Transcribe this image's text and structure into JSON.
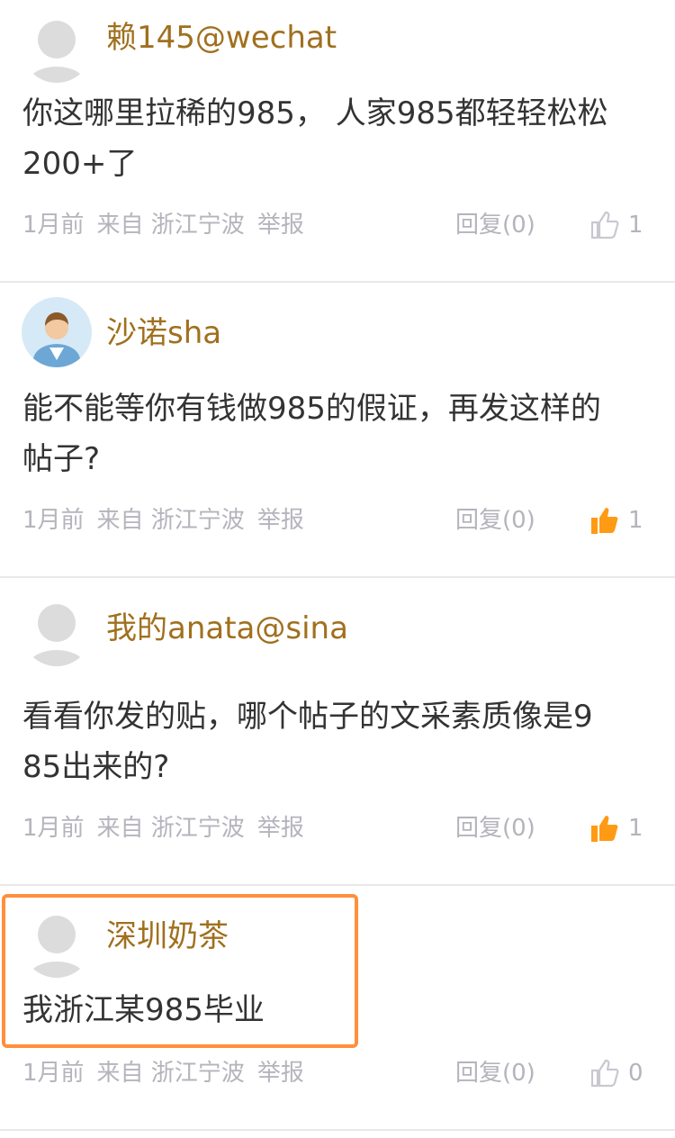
{
  "comments": [
    {
      "username": "赖145@wechat",
      "avatar": "default-avatar-icon",
      "content": "你这哪里拉稀的985， 人家985都轻轻松松\n200+了",
      "time": "1月前",
      "source": "来自 浙江宁波",
      "report": "举报",
      "reply": "回复(0)",
      "likes": "1",
      "liked": false
    },
    {
      "username": "沙诺sha",
      "avatar": "user-photo-avatar-icon",
      "content": "能不能等你有钱做985的假证，再发这样的\n帖子?",
      "time": "1月前",
      "source": "来自 浙江宁波",
      "report": "举报",
      "reply": "回复(0)",
      "likes": "1",
      "liked": true
    },
    {
      "username": "我的anata@sina",
      "avatar": "default-avatar-icon",
      "content": "看看你发的贴，哪个帖子的文采素质像是9\n85出来的?",
      "time": "1月前",
      "source": "来自 浙江宁波",
      "report": "举报",
      "reply": "回复(0)",
      "likes": "1",
      "liked": true
    },
    {
      "username": "深圳奶茶",
      "avatar": "default-avatar-icon",
      "content": "我浙江某985毕业",
      "time": "1月前",
      "source": "来自 浙江宁波",
      "report": "举报",
      "reply": "回复(0)",
      "likes": "0",
      "liked": false,
      "highlighted": true
    }
  ],
  "colors": {
    "username": "#a0701e",
    "content": "#333333",
    "meta": "#b4b4bc",
    "like_active": "#ff9a14",
    "highlight_border": "#ff8f3c",
    "divider": "#e8e8ec"
  }
}
